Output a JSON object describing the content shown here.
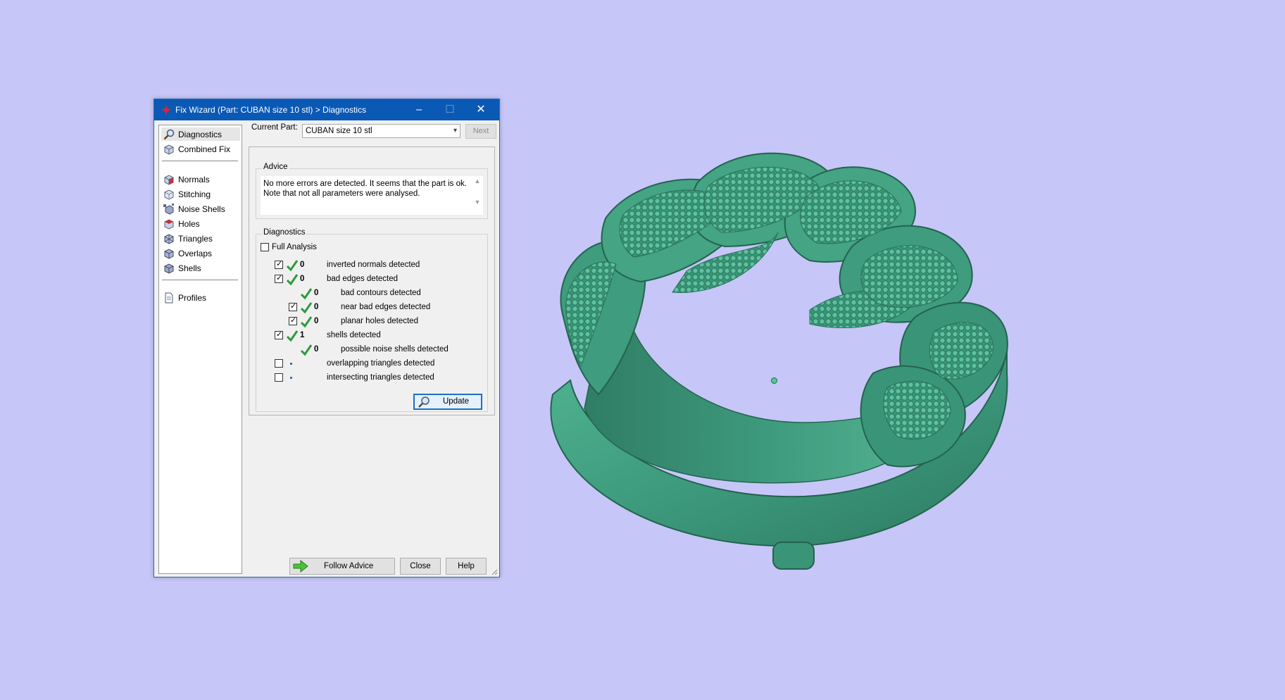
{
  "window": {
    "title": "Fix Wizard (Part: CUBAN size 10 stl) > Diagnostics",
    "controls": {
      "minimize": "–",
      "maximize": "☐",
      "close": "✕"
    }
  },
  "nav": {
    "items": [
      {
        "label": "Diagnostics",
        "icon": "magnifier-icon",
        "selected": true
      },
      {
        "label": "Combined Fix",
        "icon": "cube-icon"
      },
      {
        "label": "Normals",
        "icon": "normals-cube-icon"
      },
      {
        "label": "Stitching",
        "icon": "stitching-cube-icon"
      },
      {
        "label": "Noise Shells",
        "icon": "noise-shells-icon"
      },
      {
        "label": "Holes",
        "icon": "holes-cube-icon"
      },
      {
        "label": "Triangles",
        "icon": "triangles-cube-icon"
      },
      {
        "label": "Overlaps",
        "icon": "overlaps-cube-icon"
      },
      {
        "label": "Shells",
        "icon": "shells-cube-icon"
      },
      {
        "label": "Profiles",
        "icon": "document-icon"
      }
    ]
  },
  "current_part": {
    "label": "Current Part:",
    "value": "CUBAN size 10 stl",
    "next_label": "Next"
  },
  "advice": {
    "title": "Advice",
    "text": "No more errors are detected. It seems that the part is ok. Note that not all parameters were analysed."
  },
  "diagnostics": {
    "title": "Diagnostics",
    "full_analysis_label": "Full Analysis",
    "full_analysis_checked": false,
    "rows": [
      {
        "count": "0",
        "label": "inverted normals detected",
        "checked": true,
        "status": "ok"
      },
      {
        "count": "0",
        "label": "bad edges detected",
        "checked": true,
        "status": "ok"
      },
      {
        "count": "0",
        "label": "bad contours detected",
        "status": "ok"
      },
      {
        "count": "0",
        "label": "near bad edges detected",
        "checked": true,
        "status": "ok"
      },
      {
        "count": "0",
        "label": "planar holes detected",
        "checked": true,
        "status": "ok"
      },
      {
        "count": "1",
        "label": "shells detected",
        "checked": true,
        "status": "ok"
      },
      {
        "count": "0",
        "label": "possible noise shells detected",
        "status": "ok"
      },
      {
        "count": "",
        "label": "overlapping triangles detected",
        "checked": false,
        "status": "pending"
      },
      {
        "count": "",
        "label": "intersecting triangles detected",
        "checked": false,
        "status": "pending"
      }
    ],
    "update_label": "Update"
  },
  "buttons": {
    "follow_advice": "Follow Advice",
    "close": "Close",
    "help": "Help"
  },
  "colors": {
    "background": "#c6c6f8",
    "model": "#3d9f81",
    "titlebar": "#0a59b5",
    "check_green": "#2e9a3c"
  }
}
